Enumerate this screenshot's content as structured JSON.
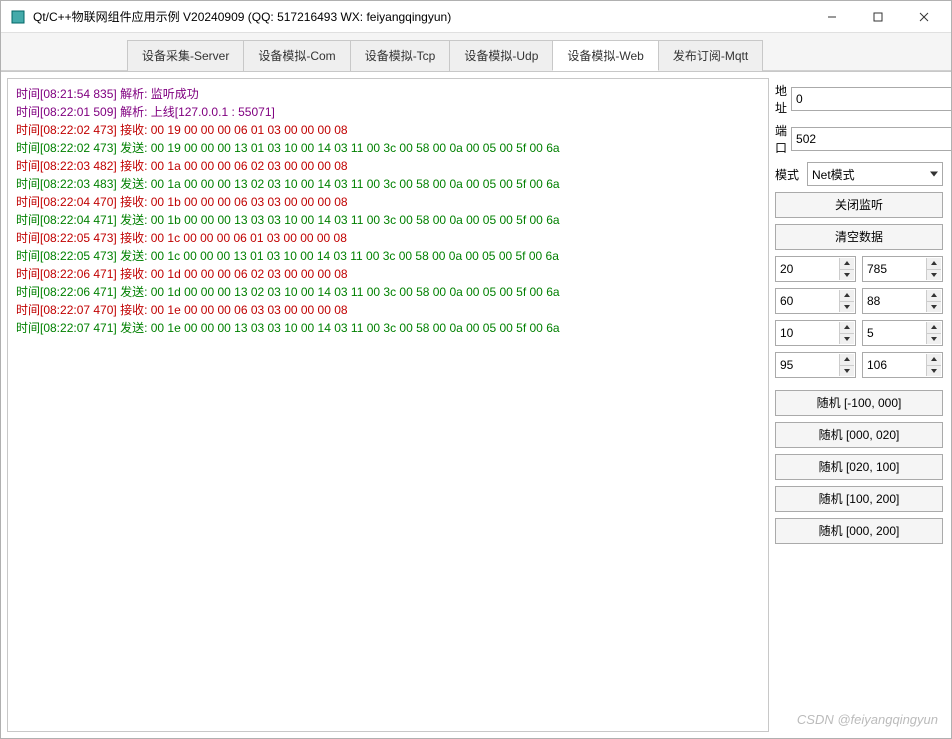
{
  "window": {
    "title": "Qt/C++物联网组件应用示例 V20240909 (QQ: 517216493 WX: feiyangqingyun)"
  },
  "tabs": [
    {
      "label": "设备采集-Server",
      "active": false
    },
    {
      "label": "设备模拟-Com",
      "active": false
    },
    {
      "label": "设备模拟-Tcp",
      "active": false
    },
    {
      "label": "设备模拟-Udp",
      "active": false
    },
    {
      "label": "设备模拟-Web",
      "active": true
    },
    {
      "label": "发布订阅-Mqtt",
      "active": false
    }
  ],
  "log": [
    {
      "color": "purple",
      "text": "时间[08:21:54 835] 解析: 监听成功"
    },
    {
      "color": "purple",
      "text": "时间[08:22:01 509] 解析: 上线[127.0.0.1 : 55071]"
    },
    {
      "color": "red",
      "text": "时间[08:22:02 473] 接收: 00 19 00 00 00 06 01 03 00 00 00 08"
    },
    {
      "color": "green",
      "text": "时间[08:22:02 473] 发送: 00 19 00 00 00 13 01 03 10 00 14 03 11 00 3c 00 58 00 0a 00 05 00 5f 00 6a"
    },
    {
      "color": "red",
      "text": "时间[08:22:03 482] 接收: 00 1a 00 00 00 06 02 03 00 00 00 08"
    },
    {
      "color": "green",
      "text": "时间[08:22:03 483] 发送: 00 1a 00 00 00 13 02 03 10 00 14 03 11 00 3c 00 58 00 0a 00 05 00 5f 00 6a"
    },
    {
      "color": "red",
      "text": "时间[08:22:04 470] 接收: 00 1b 00 00 00 06 03 03 00 00 00 08"
    },
    {
      "color": "green",
      "text": "时间[08:22:04 471] 发送: 00 1b 00 00 00 13 03 03 10 00 14 03 11 00 3c 00 58 00 0a 00 05 00 5f 00 6a"
    },
    {
      "color": "red",
      "text": "时间[08:22:05 473] 接收: 00 1c 00 00 00 06 01 03 00 00 00 08"
    },
    {
      "color": "green",
      "text": "时间[08:22:05 473] 发送: 00 1c 00 00 00 13 01 03 10 00 14 03 11 00 3c 00 58 00 0a 00 05 00 5f 00 6a"
    },
    {
      "color": "red",
      "text": "时间[08:22:06 471] 接收: 00 1d 00 00 00 06 02 03 00 00 00 08"
    },
    {
      "color": "green",
      "text": "时间[08:22:06 471] 发送: 00 1d 00 00 00 13 02 03 10 00 14 03 11 00 3c 00 58 00 0a 00 05 00 5f 00 6a"
    },
    {
      "color": "red",
      "text": "时间[08:22:07 470] 接收: 00 1e 00 00 00 06 03 03 00 00 00 08"
    },
    {
      "color": "green",
      "text": "时间[08:22:07 471] 发送: 00 1e 00 00 00 13 03 03 10 00 14 03 11 00 3c 00 58 00 0a 00 05 00 5f 00 6a"
    }
  ],
  "side": {
    "addr_label": "地址",
    "addr_value": "0",
    "port_label": "端口",
    "port_value": "502",
    "mode_label": "模式",
    "mode_value": "Net模式",
    "btn_stop": "关闭监听",
    "btn_clear": "清空数据",
    "spins": [
      {
        "a": "20",
        "b": "785"
      },
      {
        "a": "60",
        "b": "88"
      },
      {
        "a": "10",
        "b": "5"
      },
      {
        "a": "95",
        "b": "106"
      }
    ],
    "rand_buttons": [
      "随机 [-100, 000]",
      "随机 [000, 020]",
      "随机 [020, 100]",
      "随机 [100, 200]",
      "随机 [000, 200]"
    ]
  },
  "watermark": "CSDN @feiyangqingyun"
}
